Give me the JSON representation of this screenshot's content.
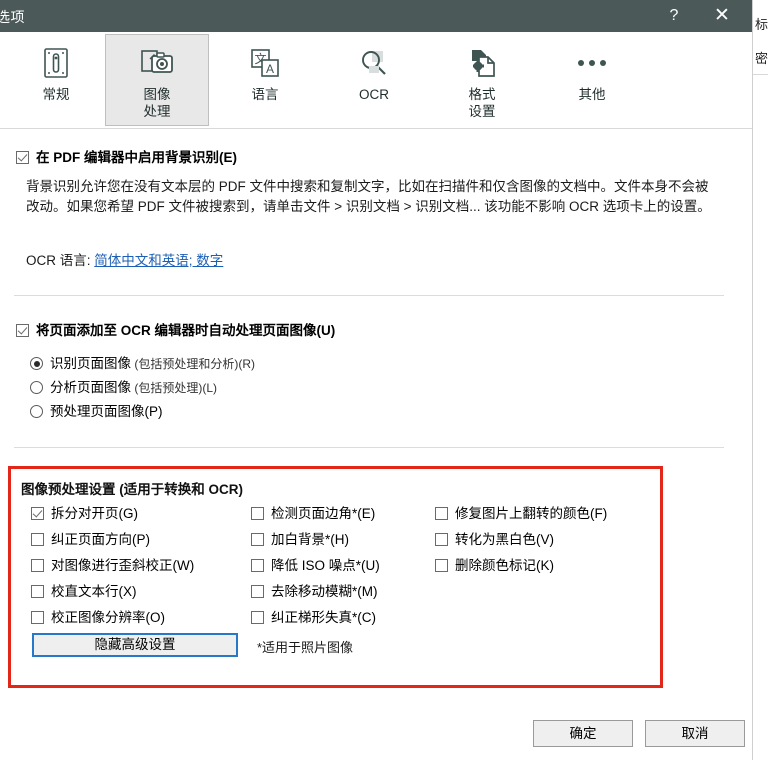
{
  "window": {
    "title": "选项",
    "help_label": "?",
    "close_label": "✕"
  },
  "background_window": {
    "title_fragment": "标",
    "sub_fragment": "密"
  },
  "tabs": [
    {
      "label": "常规",
      "icon": "general-icon",
      "selected": false
    },
    {
      "label": "图像\n处理",
      "icon": "image-processing-icon",
      "selected": true
    },
    {
      "label": "语言",
      "icon": "language-icon",
      "selected": false
    },
    {
      "label": "OCR",
      "icon": "ocr-icon",
      "selected": false
    },
    {
      "label": "格式\n设置",
      "icon": "format-settings-icon",
      "selected": false
    },
    {
      "label": "其他",
      "icon": "more-icon",
      "selected": false
    }
  ],
  "main": {
    "enable_background_recognition": {
      "label": "在 PDF 编辑器中启用背景识别(E)",
      "checked": true
    },
    "description": "背景识别允许您在没有文本层的 PDF 文件中搜索和复制文字，比如在扫描件和仅含图像的文档中。文件本身不会被改动。如果您希望 PDF 文件被搜索到，请单击文件 > 识别文档 > 识别文档...\n该功能不影响 OCR 选项卡上的设置。",
    "ocr_language": {
      "label": "OCR 语言:",
      "value": "简体中文和英语; 数字"
    },
    "auto_process": {
      "label": "将页面添加至 OCR 编辑器时自动处理页面图像(U)",
      "checked": true
    },
    "process_modes": [
      {
        "label": "识别页面图像",
        "suffix": " (包括预处理和分析)(R)",
        "selected": true
      },
      {
        "label": "分析页面图像",
        "suffix": " (包括预处理)(L)",
        "selected": false
      },
      {
        "label": "预处理页面图像(P)",
        "suffix": "",
        "selected": false
      }
    ],
    "preprocessing": {
      "title": "图像预处理设置  (适用于转换和 OCR)",
      "column_1": [
        {
          "label": "拆分对开页(G)",
          "checked": true
        },
        {
          "label": "纠正页面方向(P)",
          "checked": false
        },
        {
          "label": "对图像进行歪斜校正(W)",
          "checked": false
        },
        {
          "label": "校直文本行(X)",
          "checked": false
        },
        {
          "label": "校正图像分辨率(O)",
          "checked": false
        }
      ],
      "column_2": [
        {
          "label": "检测页面边角*(E)",
          "checked": false
        },
        {
          "label": "加白背景*(H)",
          "checked": false
        },
        {
          "label": "降低 ISO 噪点*(U)",
          "checked": false
        },
        {
          "label": "去除移动模糊*(M)",
          "checked": false
        },
        {
          "label": "纠正梯形失真*(C)",
          "checked": false
        }
      ],
      "column_3": [
        {
          "label": "修复图片上翻转的颜色(F)",
          "checked": false
        },
        {
          "label": "转化为黑白色(V)",
          "checked": false
        },
        {
          "label": "删除颜色标记(K)",
          "checked": false
        }
      ],
      "toggle_advanced_label": "隐藏高级设置",
      "photo_note": "*适用于照片图像"
    }
  },
  "footer": {
    "ok_label": "确定",
    "cancel_label": "取消"
  },
  "colors": {
    "titlebar": "#4b5a59",
    "highlight_border": "#e22718",
    "link": "#1c5fb5",
    "focus_border": "#2878c8",
    "icon": "#3f5552"
  }
}
